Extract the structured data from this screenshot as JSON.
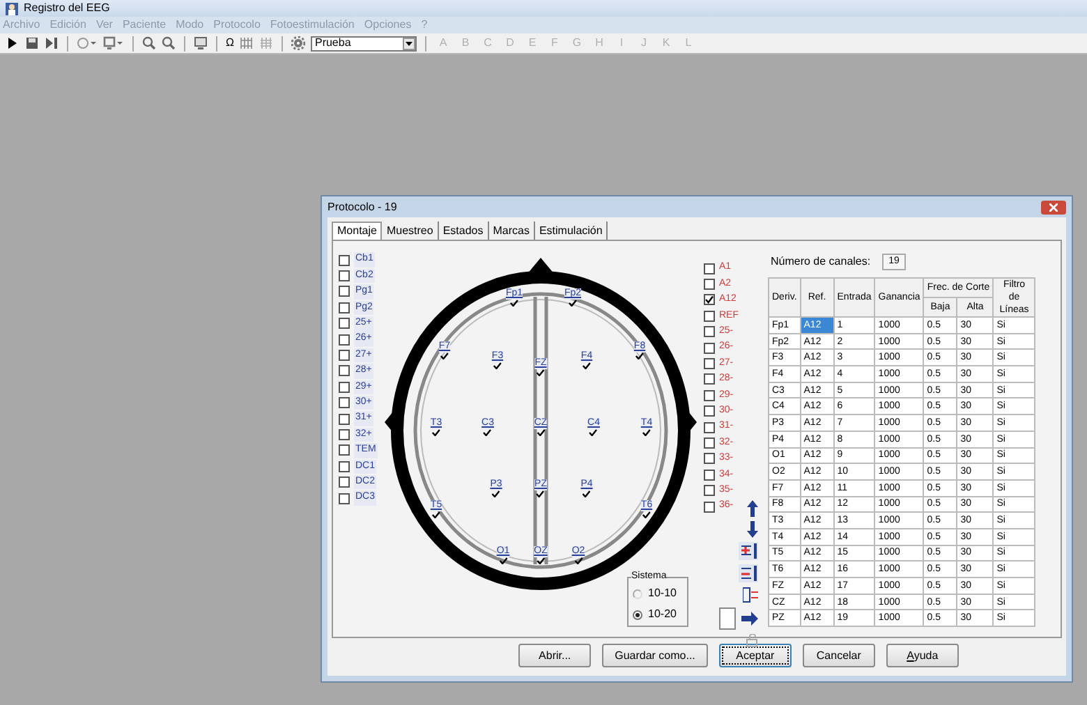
{
  "window": {
    "title": "Registro del EEG"
  },
  "menu": [
    "Archivo",
    "Edición",
    "Ver",
    "Paciente",
    "Modo",
    "Protocolo",
    "Fotoestimulación",
    "Opciones",
    "?"
  ],
  "toolbar": {
    "symbol": "Ω",
    "combo_value": "Prueba",
    "letters": [
      "A",
      "B",
      "C",
      "D",
      "E",
      "F",
      "G",
      "H",
      "I",
      "J",
      "K",
      "L"
    ]
  },
  "dialog": {
    "title": "Protocolo - 19",
    "tabs": [
      {
        "label": "Montaje",
        "selected": true
      },
      {
        "label": "Muestreo",
        "selected": false
      },
      {
        "label": "Estados",
        "selected": false
      },
      {
        "label": "Marcas",
        "selected": false
      },
      {
        "label": "Estimulación",
        "selected": false
      }
    ],
    "left_channels": [
      {
        "label": "Cb1",
        "checked": false
      },
      {
        "label": "Cb2",
        "checked": false
      },
      {
        "label": "Pg1",
        "checked": false
      },
      {
        "label": "Pg2",
        "checked": false
      },
      {
        "label": "25+",
        "checked": false
      },
      {
        "label": "26+",
        "checked": false
      },
      {
        "label": "27+",
        "checked": false
      },
      {
        "label": "28+",
        "checked": false
      },
      {
        "label": "29+",
        "checked": false
      },
      {
        "label": "30+",
        "checked": false
      },
      {
        "label": "31+",
        "checked": false
      },
      {
        "label": "32+",
        "checked": false
      },
      {
        "label": "TEM",
        "checked": false
      },
      {
        "label": "DC1",
        "checked": false
      },
      {
        "label": "DC2",
        "checked": false
      },
      {
        "label": "DC3",
        "checked": false
      }
    ],
    "electrodes": [
      {
        "label": "Fp1",
        "checked": true
      },
      {
        "label": "Fp2",
        "checked": true
      },
      {
        "label": "F7",
        "checked": true
      },
      {
        "label": "F3",
        "checked": true
      },
      {
        "label": "FZ",
        "checked": true
      },
      {
        "label": "F4",
        "checked": true
      },
      {
        "label": "F8",
        "checked": true
      },
      {
        "label": "T3",
        "checked": true
      },
      {
        "label": "C3",
        "checked": true
      },
      {
        "label": "CZ",
        "checked": true
      },
      {
        "label": "C4",
        "checked": true
      },
      {
        "label": "T4",
        "checked": true
      },
      {
        "label": "P3",
        "checked": true
      },
      {
        "label": "PZ",
        "checked": true
      },
      {
        "label": "P4",
        "checked": true
      },
      {
        "label": "T5",
        "checked": true
      },
      {
        "label": "T6",
        "checked": true
      },
      {
        "label": "O1",
        "checked": true
      },
      {
        "label": "OZ",
        "checked": true
      },
      {
        "label": "O2",
        "checked": true
      }
    ],
    "right_channels": [
      {
        "label": "A1",
        "checked": false
      },
      {
        "label": "A2",
        "checked": false
      },
      {
        "label": "A12",
        "checked": true
      },
      {
        "label": "REF",
        "checked": false
      },
      {
        "label": "25-",
        "checked": false
      },
      {
        "label": "26-",
        "checked": false
      },
      {
        "label": "27-",
        "checked": false
      },
      {
        "label": "28-",
        "checked": false
      },
      {
        "label": "29-",
        "checked": false
      },
      {
        "label": "30-",
        "checked": false
      },
      {
        "label": "31-",
        "checked": false
      },
      {
        "label": "32-",
        "checked": false
      },
      {
        "label": "33-",
        "checked": false
      },
      {
        "label": "34-",
        "checked": false
      },
      {
        "label": "35-",
        "checked": false
      },
      {
        "label": "36-",
        "checked": false
      }
    ],
    "system": {
      "title": "Sistema",
      "options": [
        {
          "label": "10-10",
          "selected": false
        },
        {
          "label": "10-20",
          "selected": true
        }
      ]
    },
    "channel_count": {
      "label": "Número de canales:",
      "value": "19"
    },
    "table": {
      "columns": [
        "Deriv.",
        "Ref.",
        "Entrada",
        "Ganancia"
      ],
      "group": {
        "label": "Frec. de Corte",
        "columns": [
          "Baja",
          "Alta"
        ]
      },
      "last_column": "Filtro de Líneas",
      "rows": [
        {
          "cells": [
            "Fp1",
            "A12",
            "1",
            "1000",
            "0.5",
            "30",
            "Si"
          ],
          "selected": true
        },
        {
          "cells": [
            "Fp2",
            "A12",
            "2",
            "1000",
            "0.5",
            "30",
            "Si"
          ],
          "selected": false
        },
        {
          "cells": [
            "F3",
            "A12",
            "3",
            "1000",
            "0.5",
            "30",
            "Si"
          ],
          "selected": false
        },
        {
          "cells": [
            "F4",
            "A12",
            "4",
            "1000",
            "0.5",
            "30",
            "Si"
          ],
          "selected": false
        },
        {
          "cells": [
            "C3",
            "A12",
            "5",
            "1000",
            "0.5",
            "30",
            "Si"
          ],
          "selected": false
        },
        {
          "cells": [
            "C4",
            "A12",
            "6",
            "1000",
            "0.5",
            "30",
            "Si"
          ],
          "selected": false
        },
        {
          "cells": [
            "P3",
            "A12",
            "7",
            "1000",
            "0.5",
            "30",
            "Si"
          ],
          "selected": false
        },
        {
          "cells": [
            "P4",
            "A12",
            "8",
            "1000",
            "0.5",
            "30",
            "Si"
          ],
          "selected": false
        },
        {
          "cells": [
            "O1",
            "A12",
            "9",
            "1000",
            "0.5",
            "30",
            "Si"
          ],
          "selected": false
        },
        {
          "cells": [
            "O2",
            "A12",
            "10",
            "1000",
            "0.5",
            "30",
            "Si"
          ],
          "selected": false
        },
        {
          "cells": [
            "F7",
            "A12",
            "11",
            "1000",
            "0.5",
            "30",
            "Si"
          ],
          "selected": false
        },
        {
          "cells": [
            "F8",
            "A12",
            "12",
            "1000",
            "0.5",
            "30",
            "Si"
          ],
          "selected": false
        },
        {
          "cells": [
            "T3",
            "A12",
            "13",
            "1000",
            "0.5",
            "30",
            "Si"
          ],
          "selected": false
        },
        {
          "cells": [
            "T4",
            "A12",
            "14",
            "1000",
            "0.5",
            "30",
            "Si"
          ],
          "selected": false
        },
        {
          "cells": [
            "T5",
            "A12",
            "15",
            "1000",
            "0.5",
            "30",
            "Si"
          ],
          "selected": false
        },
        {
          "cells": [
            "T6",
            "A12",
            "16",
            "1000",
            "0.5",
            "30",
            "Si"
          ],
          "selected": false
        },
        {
          "cells": [
            "FZ",
            "A12",
            "17",
            "1000",
            "0.5",
            "30",
            "Si"
          ],
          "selected": false
        },
        {
          "cells": [
            "CZ",
            "A12",
            "18",
            "1000",
            "0.5",
            "30",
            "Si"
          ],
          "selected": false
        },
        {
          "cells": [
            "PZ",
            "A12",
            "19",
            "1000",
            "0.5",
            "30",
            "Si"
          ],
          "selected": false
        }
      ]
    },
    "buttons": [
      {
        "label": "Abrir...",
        "default": false,
        "mnemonic": false
      },
      {
        "label": "Guardar como...",
        "default": false,
        "mnemonic": false
      },
      {
        "label": "Aceptar",
        "default": true,
        "mnemonic": false
      },
      {
        "label": "Cancelar",
        "default": false,
        "mnemonic": false
      },
      {
        "label": "Ayuda",
        "default": false,
        "mnemonic": true
      }
    ]
  }
}
